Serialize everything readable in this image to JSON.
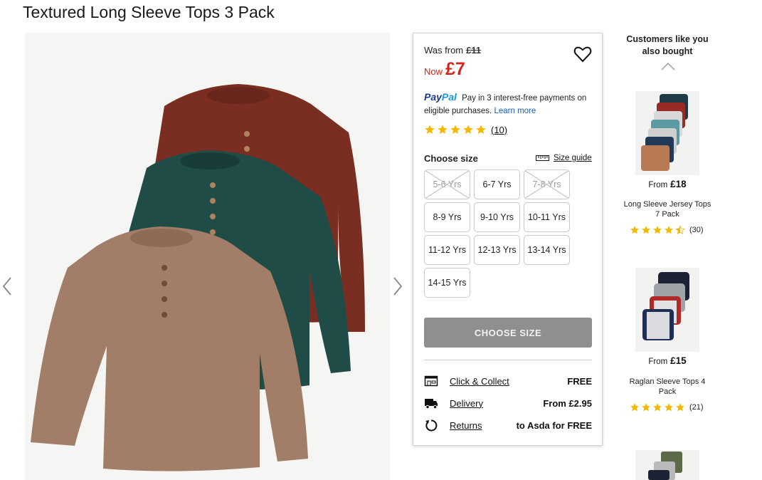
{
  "product": {
    "title": "Textured Long Sleeve Tops 3 Pack"
  },
  "price": {
    "was_label": "Was from",
    "was_value": "£11",
    "now_label": "Now",
    "now_value": "£7"
  },
  "paypal": {
    "brand_part1": "Pay",
    "brand_part2": "Pal",
    "text": "Pay in 3 interest-free payments on eligible purchases.",
    "learn_more": "Learn more"
  },
  "rating": {
    "stars": 5,
    "count": "(10)"
  },
  "sizes": {
    "label": "Choose size",
    "guide_label": "Size guide",
    "options": [
      "5-6 Yrs",
      "6-7 Yrs",
      "7-8 Yrs",
      "8-9 Yrs",
      "9-10 Yrs",
      "10-11 Yrs",
      "11-12 Yrs",
      "12-13 Yrs",
      "13-14 Yrs",
      "14-15 Yrs"
    ],
    "unavailable": [
      "5-6 Yrs",
      "7-8 Yrs"
    ]
  },
  "cta": {
    "label": "CHOOSE SIZE"
  },
  "fulfilment": {
    "click_collect": {
      "label": "Click & Collect",
      "value": "FREE"
    },
    "delivery": {
      "label": "Delivery",
      "value": "From £2.95"
    },
    "returns": {
      "label": "Returns",
      "value": "to Asda for FREE"
    }
  },
  "recommendations": {
    "title": "Customers like you also bought",
    "items": [
      {
        "from_label": "From",
        "price": "£18",
        "name": "Long Sleeve Jersey Tops 7 Pack",
        "rating": 4.5,
        "count": "(30)"
      },
      {
        "from_label": "From",
        "price": "£15",
        "name": "Raglan Sleeve Tops 4 Pack",
        "rating": 5,
        "count": "(21)"
      }
    ]
  },
  "colors": {
    "sale_red": "#d0271d",
    "star_yellow": "#f5b800",
    "button_grey": "#8f8f8f",
    "shirt_red": "#7a2e22",
    "shirt_green": "#1f4c47",
    "shirt_tan": "#a27d67"
  },
  "icons": [
    "chevron-left-icon",
    "chevron-right-icon",
    "heart-icon",
    "star-icon",
    "ruler-icon",
    "store-icon",
    "truck-icon",
    "return-icon",
    "chevron-up-icon"
  ]
}
